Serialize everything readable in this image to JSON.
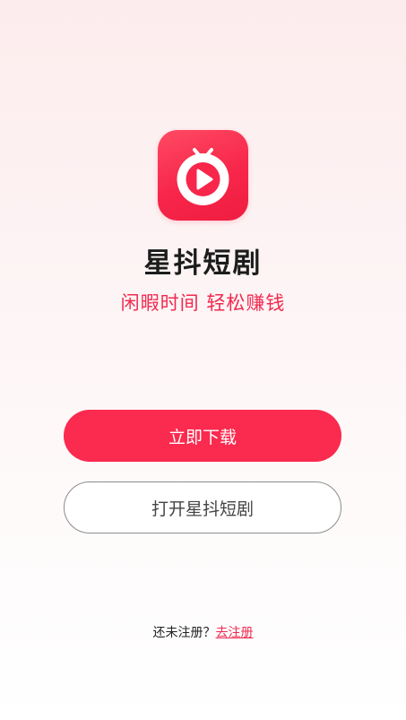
{
  "app": {
    "name": "星抖短剧",
    "slogan": "闲暇时间 轻松赚钱",
    "logo_icon": "play-clock-icon",
    "brand_color": "#fb2a4f"
  },
  "actions": {
    "download_label": "立即下载",
    "open_label": "打开星抖短剧"
  },
  "register": {
    "prompt": "还未注册？",
    "link_label": "去注册"
  }
}
